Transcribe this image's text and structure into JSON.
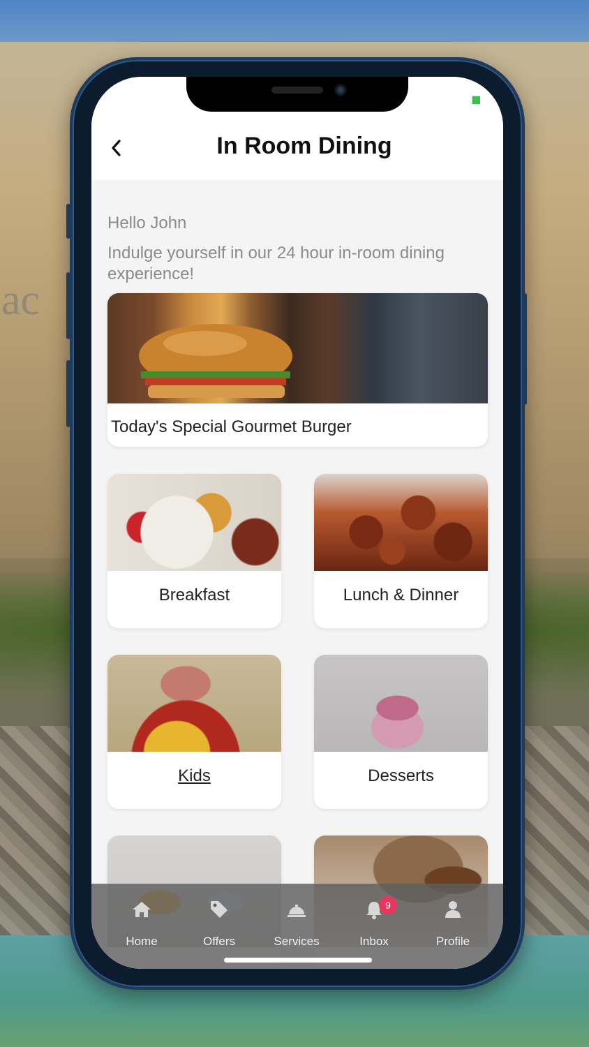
{
  "header": {
    "title": "In Room Dining",
    "back_icon": "chevron-left-icon"
  },
  "intro": {
    "greeting": "Hello John",
    "message": "Indulge yourself in our 24 hour in-room dining experience!"
  },
  "featured": {
    "label": "Today's Special Gourmet Burger"
  },
  "categories": [
    {
      "label": "Breakfast"
    },
    {
      "label": "Lunch & Dinner"
    },
    {
      "label": "Kids"
    },
    {
      "label": "Desserts"
    },
    {
      "label": ""
    },
    {
      "label": ""
    }
  ],
  "tabbar": {
    "items": [
      {
        "label": "Home",
        "icon": "home-icon"
      },
      {
        "label": "Offers",
        "icon": "tag-icon"
      },
      {
        "label": "Services",
        "icon": "service-bell-icon"
      },
      {
        "label": "Inbox",
        "icon": "bell-icon",
        "badge": "9"
      },
      {
        "label": "Profile",
        "icon": "user-icon"
      }
    ]
  },
  "colors": {
    "badge": "#e8365d",
    "status_icon": "#38c24a"
  }
}
